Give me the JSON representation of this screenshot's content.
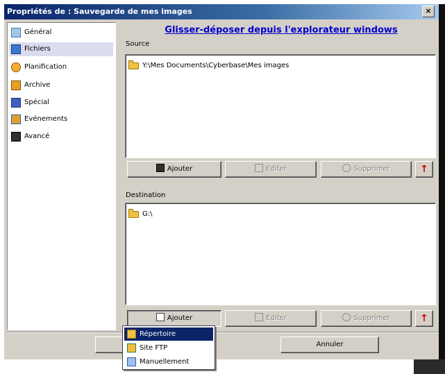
{
  "window": {
    "title": "Propriétés de : Sauvegarde de mes images",
    "close_label": "×"
  },
  "nav": {
    "items": [
      {
        "label": "Général",
        "icon": "general-icon",
        "color": "#a0c8e8"
      },
      {
        "label": "Fichiers",
        "icon": "files-icon",
        "color": "#3a78d0"
      },
      {
        "label": "Planification",
        "icon": "clock-icon",
        "color": "#f0b030"
      },
      {
        "label": "Archive",
        "icon": "archive-icon",
        "color": "#e8a020"
      },
      {
        "label": "Spécial",
        "icon": "special-icon",
        "color": "#4060c0"
      },
      {
        "label": "Evénements",
        "icon": "events-icon",
        "color": "#e0a030"
      },
      {
        "label": "Avancé",
        "icon": "advanced-icon",
        "color": "#303030"
      }
    ],
    "selected": "Fichiers"
  },
  "main": {
    "drag_drop_link": "Glisser-déposer depuis l'explorateur windows",
    "source": {
      "label": "Source",
      "items": [
        "Y:\\Mes Documents\\Cyberbase\\Mes images"
      ],
      "buttons": {
        "add": "Ajouter",
        "edit": "Editer",
        "delete": "Supprimer",
        "up": "↑"
      }
    },
    "destination": {
      "label": "Destination",
      "items": [
        "G:\\"
      ],
      "buttons": {
        "add": "Ajouter",
        "edit": "Editer",
        "delete": "Supprimer",
        "up": "↑"
      }
    }
  },
  "dropdown": {
    "items": [
      {
        "label": "Répertoire",
        "icon": "folder-icon"
      },
      {
        "label": "Site FTP",
        "icon": "ftp-icon"
      },
      {
        "label": "Manuellement",
        "icon": "manual-icon"
      }
    ],
    "highlighted": "Répertoire"
  },
  "footer": {
    "cancel_label": "Annuler"
  },
  "colors": {
    "titlebar": "#0a246a",
    "link": "#0000cc",
    "menu_highlight": "#0a246a",
    "arrow": "#cc0000",
    "dialog": "#d4d0c8"
  }
}
